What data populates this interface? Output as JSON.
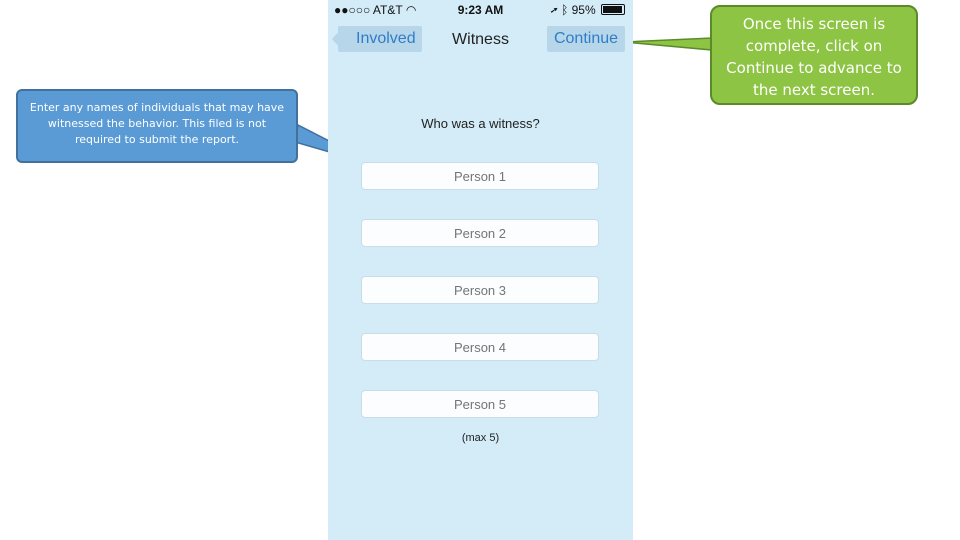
{
  "status_bar": {
    "carrier": "●●○○○ AT&T",
    "time": "9:23 AM",
    "battery": "95%"
  },
  "nav": {
    "back_label": "Involved",
    "title": "Witness",
    "continue_label": "Continue"
  },
  "form": {
    "question": "Who was a witness?",
    "persons": [
      "Person 1",
      "Person 2",
      "Person 3",
      "Person 4",
      "Person 5"
    ],
    "max_note": "(max 5)"
  },
  "callouts": {
    "witness_note": "Enter any names of individuals that may have witnessed the behavior.  This filed is not required to submit the report.",
    "continue_note": "Once this screen is complete, click on Continue to advance to the next screen."
  },
  "colors": {
    "phone_bg": "#d3ecf8",
    "ios_blue": "#2d7ec7",
    "callout_blue": "#5b9bd5",
    "callout_green": "#8dc444"
  }
}
